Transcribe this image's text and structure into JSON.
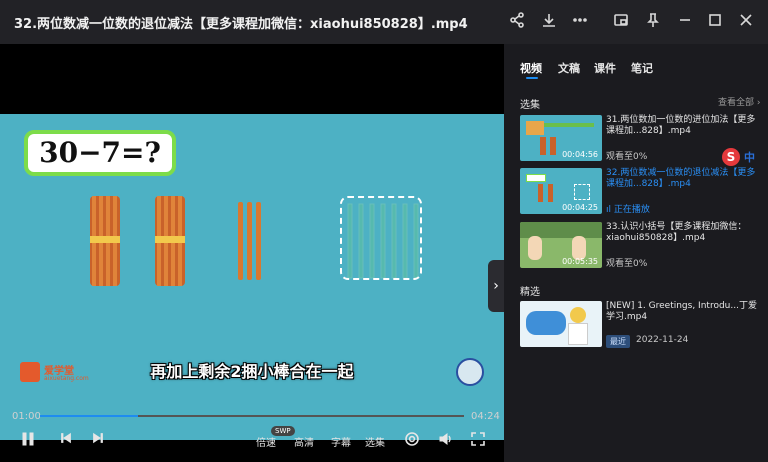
{
  "window": {
    "title": "32.两位数减一位数的退位减法【更多课程加微信：xiaohui850828】.mp4"
  },
  "video": {
    "equation": "30−7=?",
    "subtitle": "再加上剩余2捆小棒合在一起",
    "logo_text": "爱学堂",
    "logo_url": "aixuetang.com",
    "progress": 0.23
  },
  "controls": {
    "current_time": "01:00",
    "total_time": "04:24",
    "speed_label": "倍速",
    "swp_badge": "SWP",
    "quality_label": "高清",
    "subtitle_label": "字幕",
    "episodes_label": "选集"
  },
  "sidebar": {
    "tabs": [
      "视频",
      "文稿",
      "课件",
      "笔记"
    ],
    "episodes_header": "选集",
    "see_all": "查看全部",
    "episodes": [
      {
        "title": "31.两位数加一位数的进位加法【更多课程加...828】.mp4",
        "status": "观看至0%",
        "duration": "00:04:56",
        "active": false
      },
      {
        "title": "32.两位数减一位数的退位减法【更多课程加...828】.mp4",
        "status": "正在播放",
        "duration": "00:04:25",
        "active": true
      },
      {
        "title": "33.认识小括号【更多课程加微信：xiaohui850828】.mp4",
        "status": "观看至0%",
        "duration": "00:05:35",
        "active": false
      }
    ],
    "featured_header": "精选",
    "featured": {
      "title": "[NEW] 1. Greetings, Introdu...丁爱学习.mp4",
      "tag": "最近",
      "date": "2022-11-24"
    }
  },
  "ime": {
    "label": "中"
  },
  "colors": {
    "accent": "#1e8cf0",
    "scene_bg": "#4db1c4",
    "eq_border": "#7ddc4a"
  }
}
